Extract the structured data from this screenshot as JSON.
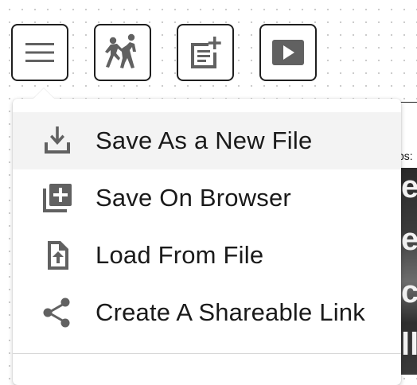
{
  "toolbar": {
    "buttons": [
      {
        "id": "menu",
        "icon": "hamburger-menu-icon"
      },
      {
        "id": "people",
        "icon": "people-fighting-icon"
      },
      {
        "id": "note",
        "icon": "add-note-icon"
      },
      {
        "id": "play",
        "icon": "play-icon"
      }
    ]
  },
  "side_panel": {
    "label": "ps:",
    "strip_chars": [
      "e",
      "e",
      "c",
      "ll"
    ]
  },
  "menu": {
    "items": [
      {
        "label": "Save As a New File",
        "icon": "download-icon"
      },
      {
        "label": "Save On Browser",
        "icon": "library-add-icon"
      },
      {
        "label": "Load From File",
        "icon": "file-upload-icon"
      },
      {
        "label": "Create A Shareable Link",
        "icon": "share-icon"
      }
    ]
  },
  "colors": {
    "border": "#1f1f1f",
    "icon_gray": "#616161",
    "text": "#1a1a1a",
    "hover_bg": "#f3f3f3"
  }
}
